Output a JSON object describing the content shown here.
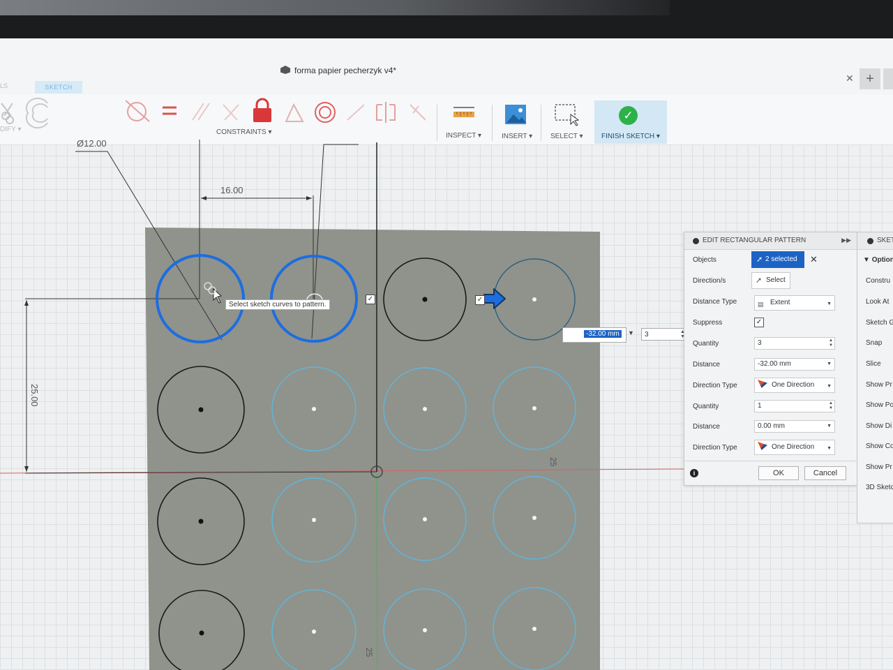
{
  "window": {
    "title": "forma papier pecherzyk v4*",
    "mode_tab": "SKETCH",
    "side_tab": "LS"
  },
  "ribbon": {
    "modify_label": "DIFY ▾",
    "constraints_label": "CONSTRAINTS ▾",
    "inspect_label": "INSPECT ▾",
    "insert_label": "INSERT ▾",
    "select_label": "SELECT ▾",
    "finish_label": "FINISH SKETCH ▾"
  },
  "canvas": {
    "dim_diameter": "Ø12.00",
    "dim_horizontal": "16.00",
    "dim_vertical": "25.00",
    "marker_right": "25",
    "marker_bottom": "25",
    "tooltip": "Select sketch curves to pattern.",
    "inline_distance": "-32.00 mm",
    "inline_quantity": "3"
  },
  "pattern_panel": {
    "title": "EDIT RECTANGULAR PATTERN",
    "rows": {
      "objects": "Objects",
      "objects_value": "2 selected",
      "direction": "Direction/s",
      "direction_value": "Select",
      "distance_type": "Distance Type",
      "distance_type_value": "Extent",
      "suppress": "Suppress",
      "quantity1": "Quantity",
      "quantity1_value": "3",
      "distance1": "Distance",
      "distance1_value": "-32.00 mm",
      "direction_type1": "Direction Type",
      "direction_type1_value": "One Direction",
      "quantity2": "Quantity",
      "quantity2_value": "1",
      "distance2": "Distance",
      "distance2_value": "0.00 mm",
      "direction_type2": "Direction Type",
      "direction_type2_value": "One Direction"
    },
    "ok": "OK",
    "cancel": "Cancel"
  },
  "sketch_palette": {
    "title": "SKET",
    "options": "Option",
    "items": [
      "Constru",
      "Look At",
      "Sketch G",
      "Snap",
      "Slice",
      "Show Pr",
      "Show Po",
      "Show Di",
      "Show Co",
      "Show Pr",
      "3D Sketc"
    ]
  },
  "colors": {
    "selected_blue": "#1d6de0",
    "pattern_cyan": "#5fb6de",
    "plate_grey": "#8f938c",
    "finish_green": "#2db24a"
  }
}
